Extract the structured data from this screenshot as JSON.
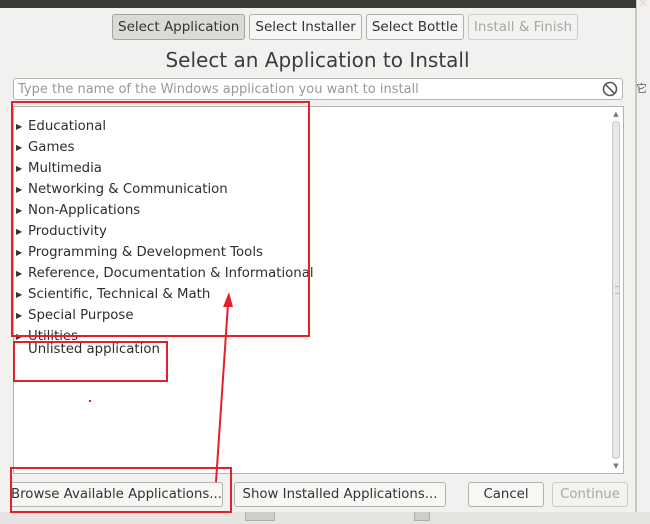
{
  "steps": [
    {
      "label": "Select Application",
      "state": "active"
    },
    {
      "label": "Select Installer",
      "state": "normal"
    },
    {
      "label": "Select Bottle",
      "state": "normal"
    },
    {
      "label": "Install & Finish",
      "state": "disabled"
    }
  ],
  "title": "Select an Application to Install",
  "search": {
    "placeholder": "Type the name of the Windows application you want to install",
    "value": ""
  },
  "categories": [
    "Educational",
    "Games",
    "Multimedia",
    "Networking & Communication",
    "Non-Applications",
    "Productivity",
    "Programming & Development Tools",
    "Reference, Documentation & Informational",
    "Scientific, Technical & Math",
    "Special Purpose",
    "Utilities"
  ],
  "unlisted_label": "Unlisted application",
  "buttons": {
    "browse": "Browse Available Applications...",
    "show_installed": "Show Installed Applications...",
    "cancel": "Cancel",
    "continue": "Continue"
  },
  "icons": {
    "clear": "clear-search-icon",
    "expander": "expander-arrow-icon",
    "window_close": "window-close-icon"
  },
  "colors": {
    "annotation": "#e3202b",
    "accent_clear": "#8b2e2a"
  },
  "background": {
    "close_glyph": "✕",
    "side_glyph": "它"
  }
}
